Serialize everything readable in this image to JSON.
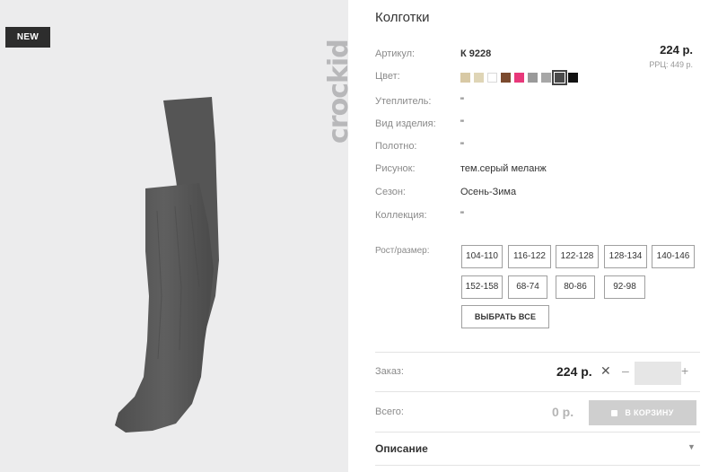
{
  "product": {
    "badge": "NEW",
    "brand": "crockid",
    "title": "Колготки",
    "price": "224 р.",
    "rrp": "РРЦ: 449 р.",
    "fields": [
      {
        "label": "Артикул:",
        "value": "К 9228"
      },
      {
        "label": "Цвет:",
        "value": ""
      },
      {
        "label": "Утеплитель:",
        "value": "\""
      },
      {
        "label": "Вид изделия:",
        "value": "\""
      },
      {
        "label": "Полотно:",
        "value": "\""
      },
      {
        "label": "Рисунок:",
        "value": "тем.серый меланж"
      },
      {
        "label": "Сезон:",
        "value": "Осень-Зима"
      },
      {
        "label": "Коллекция:",
        "value": "\""
      },
      {
        "label": "Рост/размер:",
        "value": ""
      }
    ],
    "colors": [
      "#d8c9a5",
      "#dfd5b6",
      "#ffffff",
      "#7b4a2e",
      "#e8387a",
      "#9a9a9a",
      "#a7a7a7",
      "#4a4a4a",
      "#111111"
    ],
    "selected_color_index": 7,
    "sizes": [
      "104-110",
      "116-122",
      "122-128",
      "128-134",
      "140-146",
      "152-158",
      "68-74",
      "80-86",
      "92-98"
    ],
    "select_all": "ВЫБРАТЬ ВСЕ"
  },
  "order": {
    "label": "Заказ:",
    "price": "224 р.",
    "times": "✕",
    "minus": "–",
    "plus": "+",
    "qty": ""
  },
  "total": {
    "label": "Всего:",
    "value": "0 р.",
    "cart_button": "В КОРЗИНУ"
  },
  "description": {
    "label": "Описание",
    "arrow": "▼"
  }
}
